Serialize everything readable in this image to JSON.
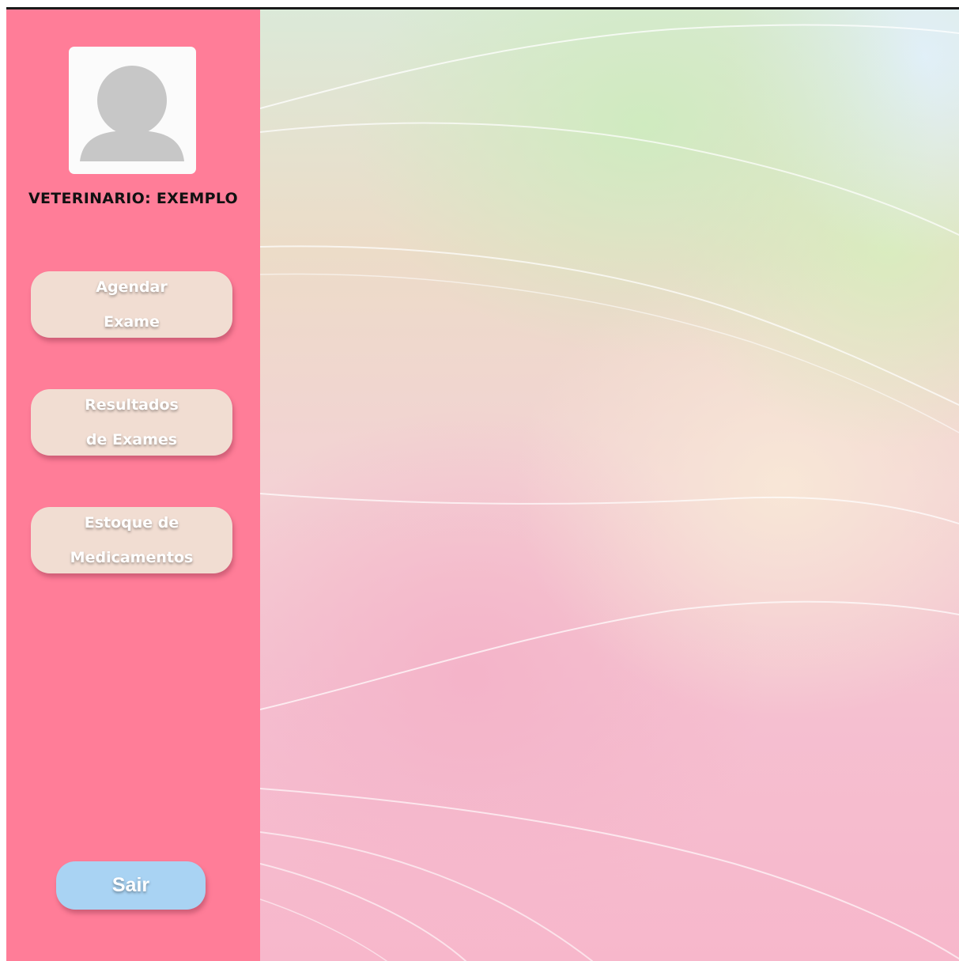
{
  "sidebar": {
    "vet_label": "VETERINARIO: EXEMPLO",
    "avatar_icon": "user-avatar-icon",
    "menu": [
      {
        "line1": "Agendar",
        "line2": "Exame"
      },
      {
        "line1": "Resultados",
        "line2": "de Exames"
      },
      {
        "line1": "Estoque de",
        "line2": "Medicamentos"
      }
    ],
    "logout_label": "Sair"
  },
  "colors": {
    "sidebar_bg": "#ff7d98",
    "menu_button_bg": "#f1ddd2",
    "logout_button_bg": "#a9d3f3",
    "avatar_bg": "#fbfbfb",
    "avatar_silhouette": "#c7c7c7"
  }
}
